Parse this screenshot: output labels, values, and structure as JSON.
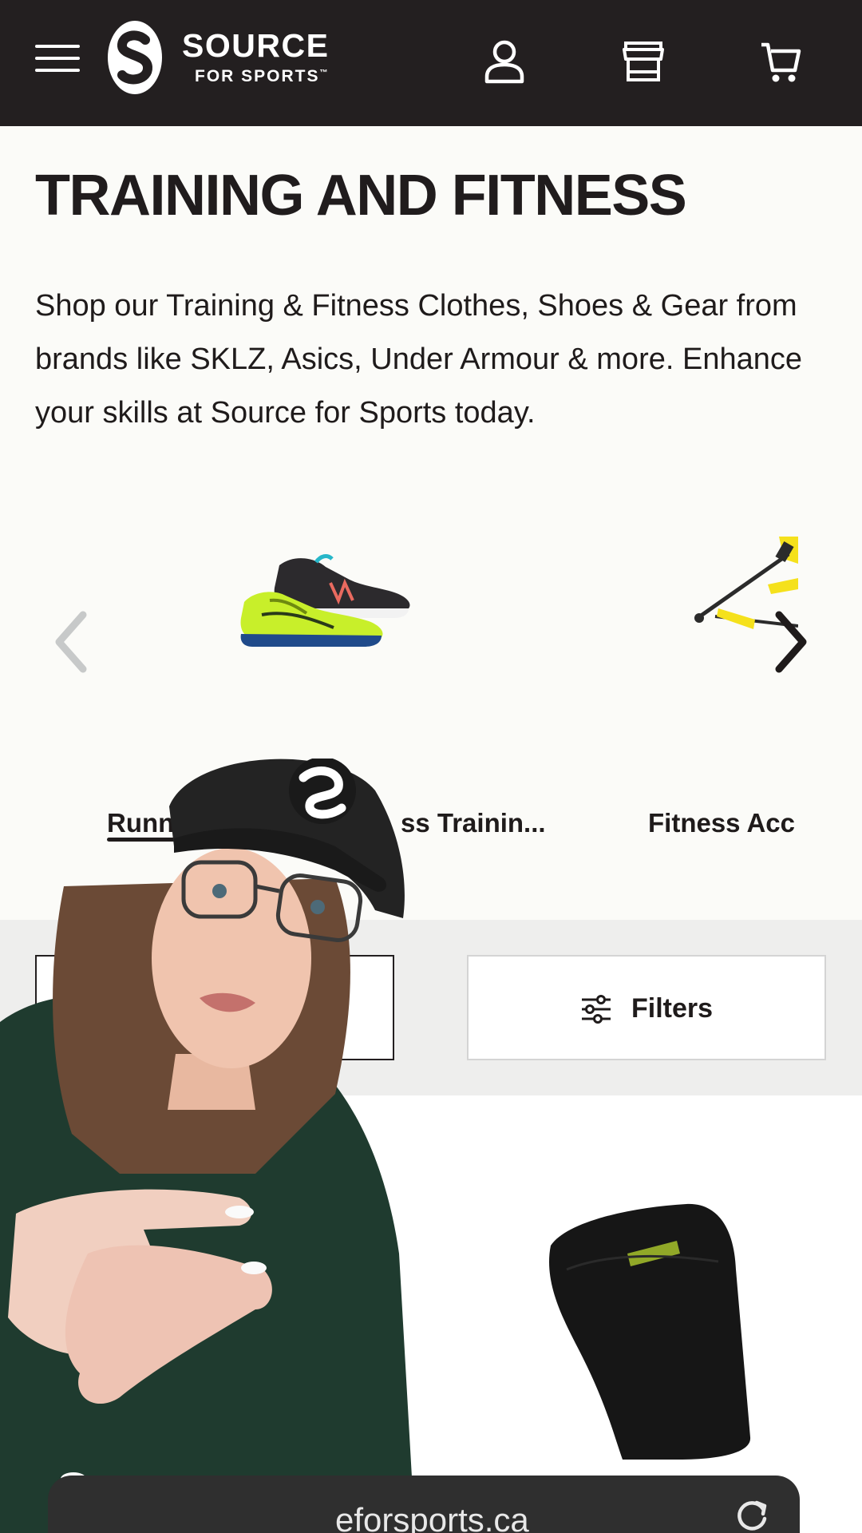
{
  "header": {
    "logo_line1": "SOURCE",
    "logo_line2": "FOR SPORTS",
    "logo_tm": "™",
    "icons": [
      "menu-icon",
      "account-icon",
      "store-icon",
      "cart-icon"
    ]
  },
  "page": {
    "title": "TRAINING AND FITNESS",
    "description": "Shop our Training & Fitness Clothes, Shoes & Gear from brands like SKLZ, Asics, Under Armour & more. Enhance your skills at Source for Sports today."
  },
  "carousel": {
    "items": [
      {
        "label": "Runnin",
        "image": "running-shoes-image"
      },
      {
        "label": "ss Trainin...",
        "image": ""
      },
      {
        "label": "Fitness Acc",
        "image": "agility-ladder-image"
      }
    ],
    "prev_icon": "chevron-left-icon",
    "next_icon": "chevron-right-icon"
  },
  "filter_bar": {
    "filters_label": "Filters",
    "filters_icon": "sliders-icon"
  },
  "browser": {
    "url_text": "eforsports.ca",
    "reload_icon": "reload-icon"
  },
  "colors": {
    "header_bg": "#231f20",
    "page_bg": "#fbfbf8",
    "filter_bar_bg": "#eeeeed",
    "accent_yellow": "#f5e11c",
    "shoe_green": "#c8ef2a"
  }
}
